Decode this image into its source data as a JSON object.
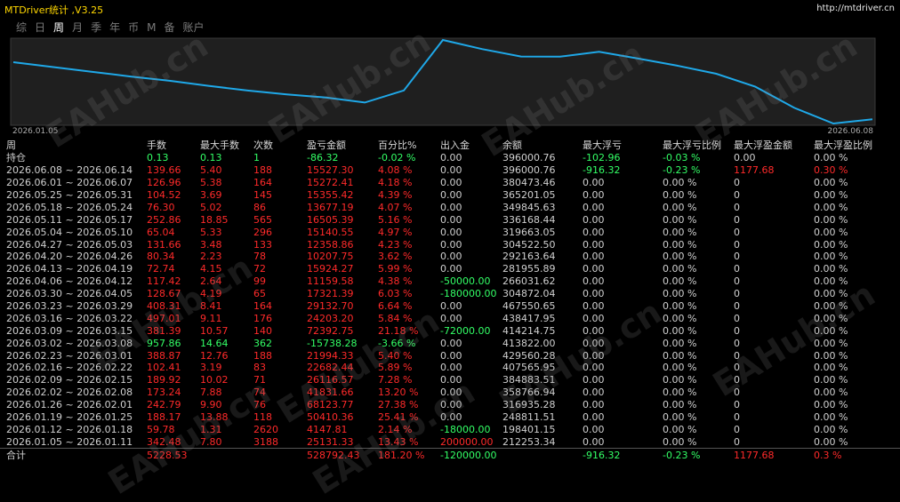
{
  "window": {
    "title": "MTDriver统计 ,V3.25",
    "url": "http://mtdriver.cn"
  },
  "tabs": [
    {
      "label": "综",
      "active": false
    },
    {
      "label": "日",
      "active": false
    },
    {
      "label": "周",
      "active": true
    },
    {
      "label": "月",
      "active": false
    },
    {
      "label": "季",
      "active": false
    },
    {
      "label": "年",
      "active": false
    },
    {
      "label": "币",
      "active": false
    },
    {
      "label": "M",
      "active": false
    },
    {
      "label": "备",
      "active": false
    },
    {
      "label": "账户",
      "active": false
    }
  ],
  "watermark": "EAHub.cn",
  "colors": {
    "title": "#ffd700",
    "line": "#1fa8e8",
    "positive": "#ff2a2a",
    "negative": "#33ff66",
    "neutral": "#d0d0d0"
  },
  "chart_data": {
    "type": "line",
    "x_start_label": "2026.01.05",
    "x_end_label": "2026.06.08",
    "series": [
      {
        "values": [
          212253,
          198401,
          248811,
          316935,
          358766,
          384883,
          407565,
          429560,
          413822,
          414214,
          438417,
          467550,
          304872,
          266031,
          281955,
          292163,
          304522,
          319663,
          336168,
          349845,
          365201,
          380473,
          396000
        ]
      }
    ],
    "grid": true
  },
  "columns": [
    "周",
    "手数",
    "最大手数",
    "次数",
    "盈亏金额",
    "百分比%",
    "出入金",
    "余额",
    "最大浮亏",
    "最大浮亏比例",
    "最大浮盈金额",
    "最大浮盈比例"
  ],
  "rows": [
    {
      "cells": [
        "持仓",
        "0.13",
        "0.13",
        "1",
        "-86.32",
        "-0.02 %",
        "0.00",
        "396000.76",
        "-102.96",
        "-0.03 %",
        "0.00",
        "0.00 %"
      ],
      "c": [
        "w",
        "g",
        "g",
        "g",
        "g",
        "g",
        "w",
        "w",
        "g",
        "g",
        "w",
        "w"
      ]
    },
    {
      "cells": [
        "2026.06.08 ~ 2026.06.14",
        "139.66",
        "5.40",
        "188",
        "15527.30",
        "4.08 %",
        "0.00",
        "396000.76",
        "-916.32",
        "-0.23 %",
        "1177.68",
        "0.30 %"
      ],
      "c": [
        "w",
        "r",
        "r",
        "r",
        "r",
        "r",
        "w",
        "w",
        "g",
        "g",
        "r",
        "r"
      ]
    },
    {
      "cells": [
        "2026.06.01 ~ 2026.06.07",
        "126.96",
        "5.38",
        "164",
        "15272.41",
        "4.18 %",
        "0.00",
        "380473.46",
        "0.00",
        "0.00 %",
        "0",
        "0.00 %"
      ],
      "c": [
        "w",
        "r",
        "r",
        "r",
        "r",
        "r",
        "w",
        "w",
        "w",
        "w",
        "w",
        "w"
      ]
    },
    {
      "cells": [
        "2026.05.25 ~ 2026.05.31",
        "104.52",
        "3.69",
        "145",
        "15355.42",
        "4.39 %",
        "0.00",
        "365201.05",
        "0.00",
        "0.00 %",
        "0",
        "0.00 %"
      ],
      "c": [
        "w",
        "r",
        "r",
        "r",
        "r",
        "r",
        "w",
        "w",
        "w",
        "w",
        "w",
        "w"
      ]
    },
    {
      "cells": [
        "2026.05.18 ~ 2026.05.24",
        "76.30",
        "5.02",
        "86",
        "13677.19",
        "4.07 %",
        "0.00",
        "349845.63",
        "0.00",
        "0.00 %",
        "0",
        "0.00 %"
      ],
      "c": [
        "w",
        "r",
        "r",
        "r",
        "r",
        "r",
        "w",
        "w",
        "w",
        "w",
        "w",
        "w"
      ]
    },
    {
      "cells": [
        "2026.05.11 ~ 2026.05.17",
        "252.86",
        "18.85",
        "565",
        "16505.39",
        "5.16 %",
        "0.00",
        "336168.44",
        "0.00",
        "0.00 %",
        "0",
        "0.00 %"
      ],
      "c": [
        "w",
        "r",
        "r",
        "r",
        "r",
        "r",
        "w",
        "w",
        "w",
        "w",
        "w",
        "w"
      ]
    },
    {
      "cells": [
        "2026.05.04 ~ 2026.05.10",
        "65.04",
        "5.33",
        "296",
        "15140.55",
        "4.97 %",
        "0.00",
        "319663.05",
        "0.00",
        "0.00 %",
        "0",
        "0.00 %"
      ],
      "c": [
        "w",
        "r",
        "r",
        "r",
        "r",
        "r",
        "w",
        "w",
        "w",
        "w",
        "w",
        "w"
      ]
    },
    {
      "cells": [
        "2026.04.27 ~ 2026.05.03",
        "131.66",
        "3.48",
        "133",
        "12358.86",
        "4.23 %",
        "0.00",
        "304522.50",
        "0.00",
        "0.00 %",
        "0",
        "0.00 %"
      ],
      "c": [
        "w",
        "r",
        "r",
        "r",
        "r",
        "r",
        "w",
        "w",
        "w",
        "w",
        "w",
        "w"
      ]
    },
    {
      "cells": [
        "2026.04.20 ~ 2026.04.26",
        "80.34",
        "2.23",
        "78",
        "10207.75",
        "3.62 %",
        "0.00",
        "292163.64",
        "0.00",
        "0.00 %",
        "0",
        "0.00 %"
      ],
      "c": [
        "w",
        "r",
        "r",
        "r",
        "r",
        "r",
        "w",
        "w",
        "w",
        "w",
        "w",
        "w"
      ]
    },
    {
      "cells": [
        "2026.04.13 ~ 2026.04.19",
        "72.74",
        "4.15",
        "72",
        "15924.27",
        "5.99 %",
        "0.00",
        "281955.89",
        "0.00",
        "0.00 %",
        "0",
        "0.00 %"
      ],
      "c": [
        "w",
        "r",
        "r",
        "r",
        "r",
        "r",
        "w",
        "w",
        "w",
        "w",
        "w",
        "w"
      ]
    },
    {
      "cells": [
        "2026.04.06 ~ 2026.04.12",
        "117.42",
        "2.64",
        "99",
        "11159.58",
        "4.38 %",
        "-50000.00",
        "266031.62",
        "0.00",
        "0.00 %",
        "0",
        "0.00 %"
      ],
      "c": [
        "w",
        "r",
        "r",
        "r",
        "r",
        "r",
        "g",
        "w",
        "w",
        "w",
        "w",
        "w"
      ]
    },
    {
      "cells": [
        "2026.03.30 ~ 2026.04.05",
        "128.67",
        "4.19",
        "65",
        "17321.39",
        "6.03 %",
        "-180000.00",
        "304872.04",
        "0.00",
        "0.00 %",
        "0",
        "0.00 %"
      ],
      "c": [
        "w",
        "r",
        "r",
        "r",
        "r",
        "r",
        "g",
        "w",
        "w",
        "w",
        "w",
        "w"
      ]
    },
    {
      "cells": [
        "2026.03.23 ~ 2026.03.29",
        "408.31",
        "8.41",
        "164",
        "29132.70",
        "6.64 %",
        "0.00",
        "467550.65",
        "0.00",
        "0.00 %",
        "0",
        "0.00 %"
      ],
      "c": [
        "w",
        "r",
        "r",
        "r",
        "r",
        "r",
        "w",
        "w",
        "w",
        "w",
        "w",
        "w"
      ]
    },
    {
      "cells": [
        "2026.03.16 ~ 2026.03.22",
        "497.01",
        "9.11",
        "176",
        "24203.20",
        "5.84 %",
        "0.00",
        "438417.95",
        "0.00",
        "0.00 %",
        "0",
        "0.00 %"
      ],
      "c": [
        "w",
        "r",
        "r",
        "r",
        "r",
        "r",
        "w",
        "w",
        "w",
        "w",
        "w",
        "w"
      ]
    },
    {
      "cells": [
        "2026.03.09 ~ 2026.03.15",
        "381.39",
        "10.57",
        "140",
        "72392.75",
        "21.18 %",
        "-72000.00",
        "414214.75",
        "0.00",
        "0.00 %",
        "0",
        "0.00 %"
      ],
      "c": [
        "w",
        "r",
        "r",
        "r",
        "r",
        "r",
        "g",
        "w",
        "w",
        "w",
        "w",
        "w"
      ]
    },
    {
      "cells": [
        "2026.03.02 ~ 2026.03.08",
        "957.86",
        "14.64",
        "362",
        "-15738.28",
        "-3.66 %",
        "0.00",
        "413822.00",
        "0.00",
        "0.00 %",
        "0",
        "0.00 %"
      ],
      "c": [
        "w",
        "g",
        "g",
        "g",
        "g",
        "g",
        "w",
        "w",
        "w",
        "w",
        "w",
        "w"
      ]
    },
    {
      "cells": [
        "2026.02.23 ~ 2026.03.01",
        "388.87",
        "12.76",
        "188",
        "21994.33",
        "5.40 %",
        "0.00",
        "429560.28",
        "0.00",
        "0.00 %",
        "0",
        "0.00 %"
      ],
      "c": [
        "w",
        "r",
        "r",
        "r",
        "r",
        "r",
        "w",
        "w",
        "w",
        "w",
        "w",
        "w"
      ]
    },
    {
      "cells": [
        "2026.02.16 ~ 2026.02.22",
        "102.41",
        "3.19",
        "83",
        "22682.44",
        "5.89 %",
        "0.00",
        "407565.95",
        "0.00",
        "0.00 %",
        "0",
        "0.00 %"
      ],
      "c": [
        "w",
        "r",
        "r",
        "r",
        "r",
        "r",
        "w",
        "w",
        "w",
        "w",
        "w",
        "w"
      ]
    },
    {
      "cells": [
        "2026.02.09 ~ 2026.02.15",
        "189.92",
        "10.02",
        "71",
        "26116.57",
        "7.28 %",
        "0.00",
        "384883.51",
        "0.00",
        "0.00 %",
        "0",
        "0.00 %"
      ],
      "c": [
        "w",
        "r",
        "r",
        "r",
        "r",
        "r",
        "w",
        "w",
        "w",
        "w",
        "w",
        "w"
      ]
    },
    {
      "cells": [
        "2026.02.02 ~ 2026.02.08",
        "173.24",
        "7.88",
        "74",
        "41831.66",
        "13.20 %",
        "0.00",
        "358766.94",
        "0.00",
        "0.00 %",
        "0",
        "0.00 %"
      ],
      "c": [
        "w",
        "r",
        "r",
        "r",
        "r",
        "r",
        "w",
        "w",
        "w",
        "w",
        "w",
        "w"
      ]
    },
    {
      "cells": [
        "2026.01.26 ~ 2026.02.01",
        "242.79",
        "9.90",
        "76",
        "68123.77",
        "27.38 %",
        "0.00",
        "316935.28",
        "0.00",
        "0.00 %",
        "0",
        "0.00 %"
      ],
      "c": [
        "w",
        "r",
        "r",
        "r",
        "r",
        "r",
        "w",
        "w",
        "w",
        "w",
        "w",
        "w"
      ]
    },
    {
      "cells": [
        "2026.01.19 ~ 2026.01.25",
        "188.17",
        "13.88",
        "118",
        "50410.36",
        "25.41 %",
        "0.00",
        "248811.51",
        "0.00",
        "0.00 %",
        "0",
        "0.00 %"
      ],
      "c": [
        "w",
        "r",
        "r",
        "r",
        "r",
        "r",
        "w",
        "w",
        "w",
        "w",
        "w",
        "w"
      ]
    },
    {
      "cells": [
        "2026.01.12 ~ 2026.01.18",
        "59.78",
        "1.31",
        "2620",
        "4147.81",
        "2.14 %",
        "-18000.00",
        "198401.15",
        "0.00",
        "0.00 %",
        "0",
        "0.00 %"
      ],
      "c": [
        "w",
        "r",
        "r",
        "r",
        "r",
        "r",
        "g",
        "w",
        "w",
        "w",
        "w",
        "w"
      ]
    },
    {
      "cells": [
        "2026.01.05 ~ 2026.01.11",
        "342.48",
        "7.80",
        "3188",
        "25131.33",
        "13.43 %",
        "200000.00",
        "212253.34",
        "0.00",
        "0.00 %",
        "0",
        "0.00 %"
      ],
      "c": [
        "w",
        "r",
        "r",
        "r",
        "r",
        "r",
        "r",
        "w",
        "w",
        "w",
        "w",
        "w"
      ]
    }
  ],
  "total": {
    "cells": [
      "合计",
      "5228.53",
      "",
      "",
      "528792.43",
      "181.20 %",
      "-120000.00",
      "",
      "-916.32",
      "-0.23 %",
      "1177.68",
      "0.3 %"
    ],
    "c": [
      "w",
      "r",
      "w",
      "w",
      "r",
      "r",
      "g",
      "w",
      "g",
      "g",
      "r",
      "r"
    ]
  }
}
